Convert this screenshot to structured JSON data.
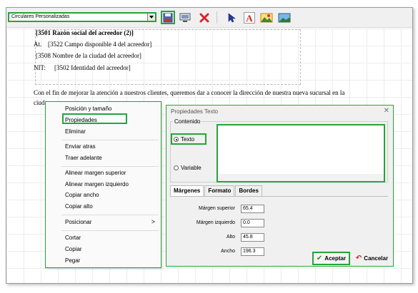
{
  "toolbar": {
    "template_select": "Circulares Personalizadas",
    "icons": [
      "save-icon",
      "preview-icon",
      "delete-icon",
      "pointer-icon",
      "text-icon",
      "image-icon",
      "landscape-icon"
    ]
  },
  "document": {
    "line1": "[3501 Razón social del acreedor (2)]",
    "line2_prefix": "At.",
    "line2": "[3522 Campo disponible 4 del acreedor]",
    "line3": "[3508 Nombre de la ciudad del acreedor]",
    "line4_prefix": "NIT:",
    "line4": "[3502 Identidad del acreedor]",
    "paragraph": "Con el fin de mejorar la atención a nuestros clientes, queremos dar a conocer la dirección de nuestra nueva sucursal en la",
    "paragraph_cont": "ciud"
  },
  "context_menu": {
    "items": [
      "Posición y tamaño",
      "Propiedades",
      "Eliminar",
      "Enviar atras",
      "Traer adelante",
      "Alinear margen superior",
      "Alinear margen izquierdo",
      "Copiar ancho",
      "Copiar alto",
      "Posicionar",
      "Cortar",
      "Copiar",
      "Pegar"
    ],
    "submenu_arrow": ">"
  },
  "dialog": {
    "title": "Propiedades Texto",
    "close": "✕",
    "group_label": "Contenido",
    "radio_text": "Texto",
    "radio_variable": "Variable",
    "tabs": [
      "Márgenes",
      "Formato",
      "Bordes"
    ],
    "fields": {
      "margin_top_label": "Márgen superior",
      "margin_top_value": "65.4",
      "margin_left_label": "Márgen izquierdo",
      "margin_left_value": "0.0",
      "height_label": "Alto",
      "height_value": "45.8",
      "width_label": "Ancho",
      "width_value": "196.3"
    },
    "ok_label": "Aceptar",
    "cancel_label": "Cancelar"
  },
  "colors": {
    "highlight": "#27a33b"
  }
}
